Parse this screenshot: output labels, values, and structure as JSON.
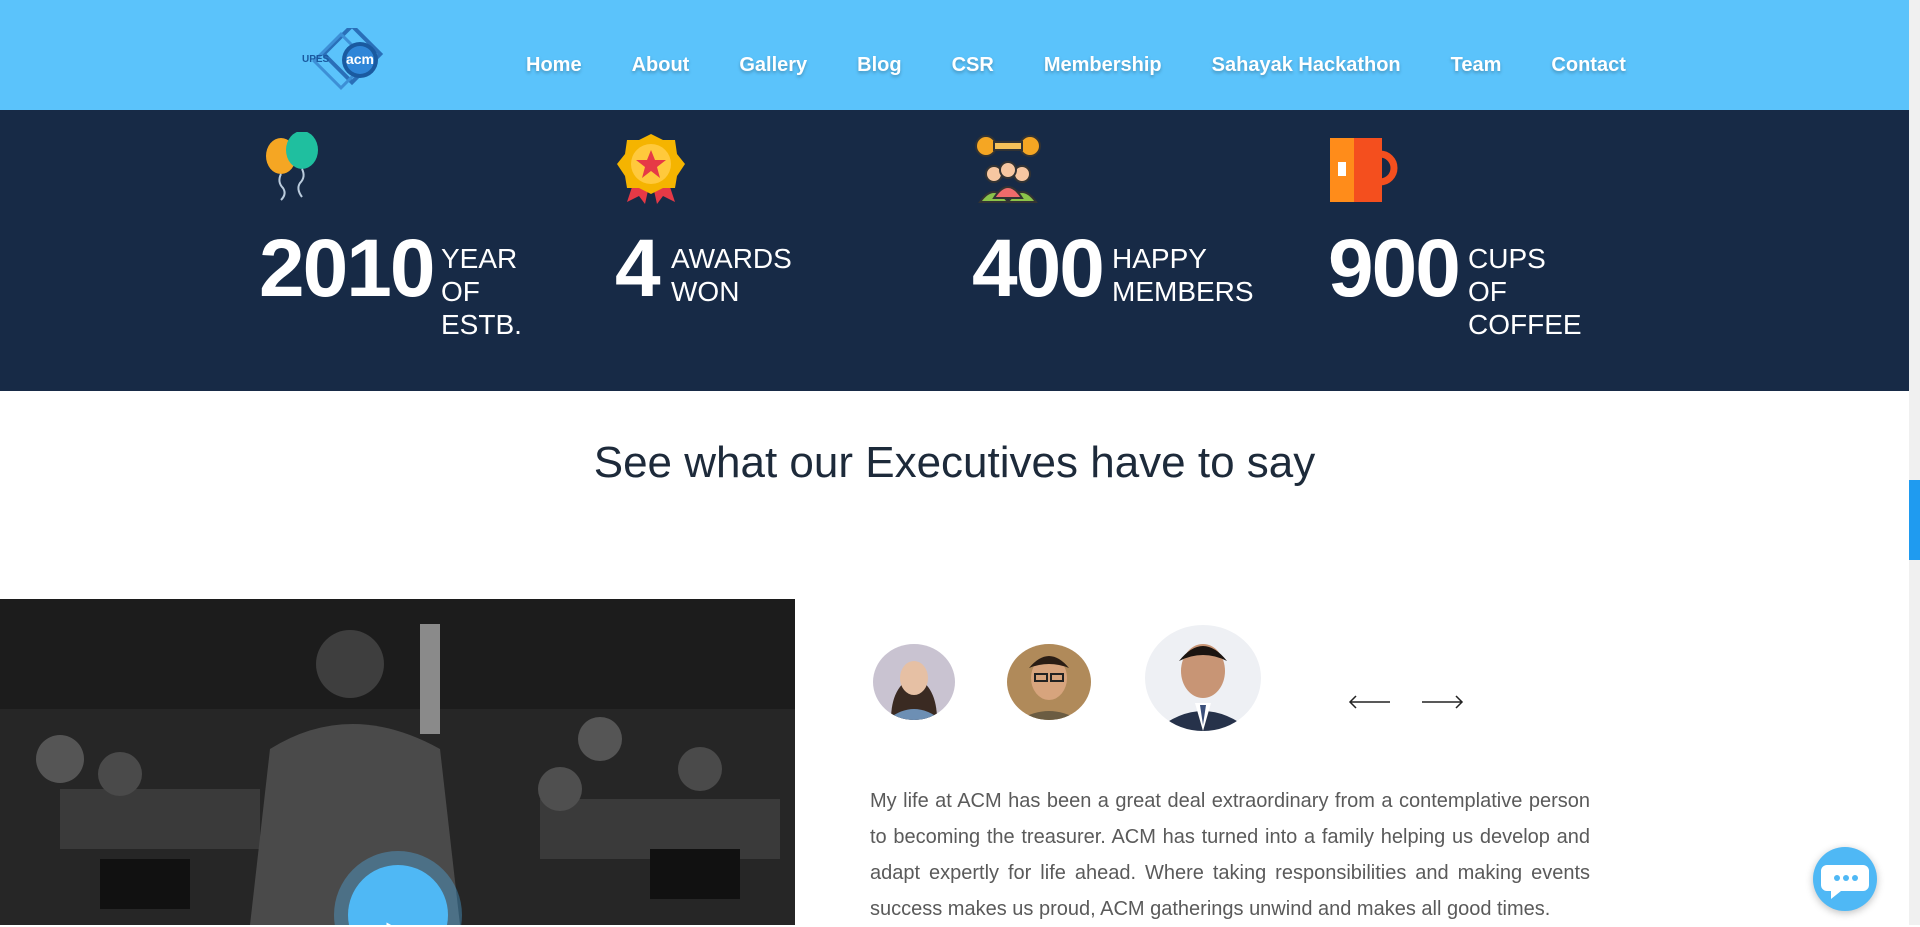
{
  "nav": {
    "logo_text": "UPES acm",
    "links": [
      "Home",
      "About",
      "Gallery",
      "Blog",
      "CSR",
      "Membership",
      "Sahayak Hackathon",
      "Team",
      "Contact"
    ]
  },
  "stats": [
    {
      "number": "2010",
      "line1": "YEAR",
      "line2": "OF ESTB.",
      "icon": "balloons-icon"
    },
    {
      "number": "4",
      "line1": "AWARDS",
      "line2": "WON",
      "icon": "medal-icon"
    },
    {
      "number": "400",
      "line1": "HAPPY",
      "line2": "MEMBERS",
      "icon": "team-gears-icon"
    },
    {
      "number": "900",
      "line1": "CUPS",
      "line2": "OF COFFEE",
      "icon": "coffee-mug-icon"
    }
  ],
  "section": {
    "heading": "See what our Executives have to say"
  },
  "testimonial": {
    "quote": "My life at ACM has been a great deal extraordinary from a contemplative person to becoming the treasurer. ACM has turned into a family helping us develop and adapt expertly for life ahead. Where taking responsibilities and making events success makes us proud, ACM gatherings unwind and makes all good times."
  },
  "colors": {
    "navbar": "#5bc3fb",
    "stats_bg": "#172a46",
    "accent": "#4fb8f5"
  }
}
